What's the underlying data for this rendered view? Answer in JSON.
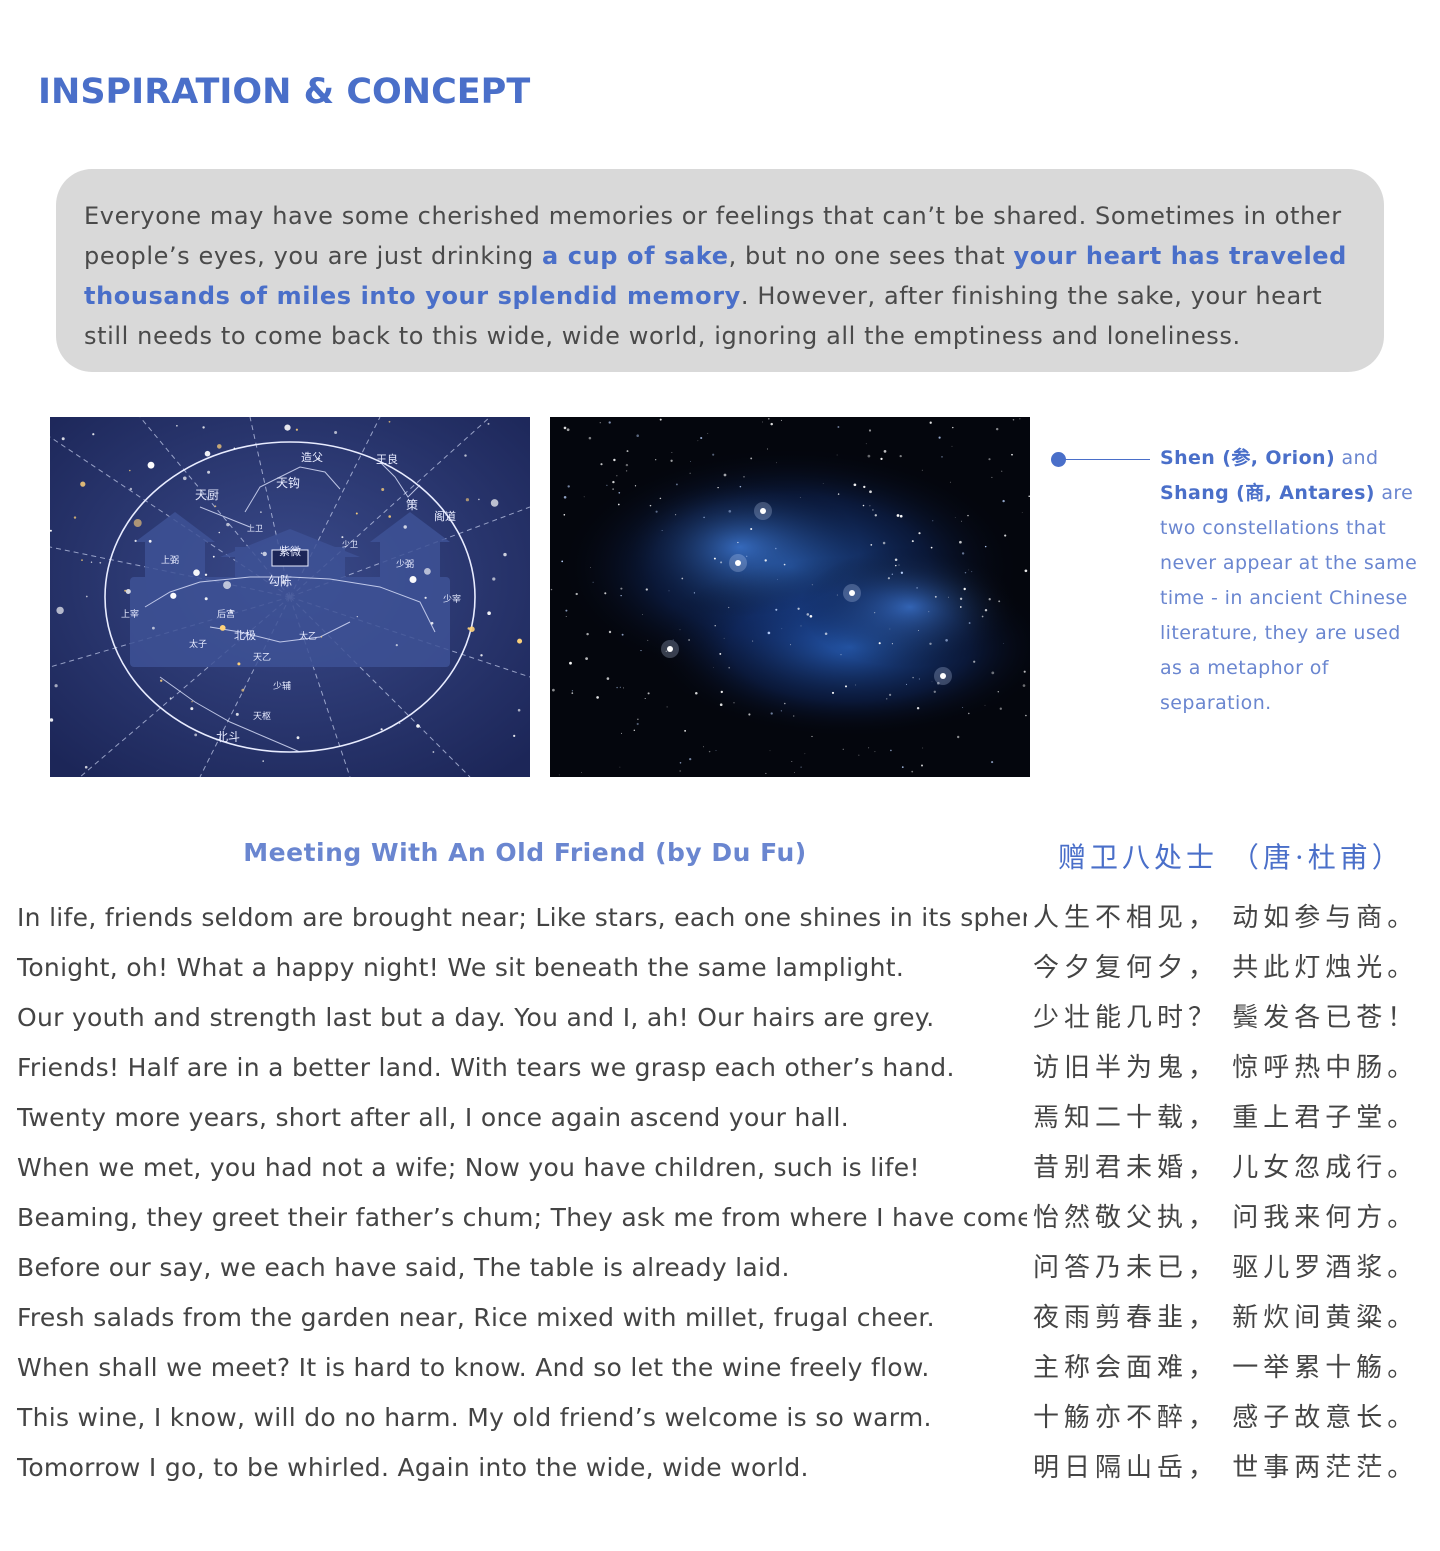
{
  "section": {
    "title": "INSPIRATION & CONCEPT"
  },
  "intro": {
    "p1": "Everyone may have some cherished memories or feelings that can’t be shared. Sometimes in other people’s eyes, you are just drinking ",
    "hl1": "a cup of sake",
    "p2": ", but no one sees that ",
    "hl2": "your heart has traveled thousands of miles into your splendid memory",
    "p3": ". However, after finishing the sake, your heart still needs to come back to this wide, wide world, ignoring all the emptiness and loneliness."
  },
  "images": {
    "left": {
      "name": "chinese-star-map-image",
      "labels": [
        "紫微",
        "天钩",
        "造父",
        "王良",
        "天厨",
        "策",
        "阁道",
        "勾陈",
        "北极",
        "北斗",
        "天枢",
        "少辅",
        "上卫",
        "少卫",
        "上弼",
        "少弼",
        "上宰",
        "少宰",
        "太子",
        "后宫",
        "天乙",
        "太乙"
      ]
    },
    "right": {
      "name": "starry-nebula-image"
    }
  },
  "callout": {
    "b1": "Shen (参, Orion)",
    "t1": " and ",
    "b2": "Shang (商, Antares)",
    "t2": " are two constellations that never appear at the same time - in ancient Chinese literature, they are used as a metaphor of separation."
  },
  "poem": {
    "title_en": "Meeting With An Old Friend (by Du Fu)",
    "title_zh": "赠卫八处士 （唐·杜甫）",
    "lines_en": [
      "In life, friends seldom are brought near; Like stars, each one shines in its sphere.",
      "Tonight, oh! What a happy night! We sit beneath the same lamplight.",
      "Our youth and strength last but a day. You and I, ah! Our hairs are grey.",
      "Friends! Half are in a better land. With tears we grasp each other’s hand.",
      "Twenty more years, short after all, I once again ascend your hall.",
      "When we met, you had not a wife; Now you have children, such is life!",
      "Beaming, they greet their father’s chum; They ask me from where I have come.",
      "Before our say, we each have said, The table is already laid.",
      "Fresh salads from the garden near, Rice mixed with millet, frugal cheer.",
      "When shall we meet? It is hard to know. And so let the wine freely flow.",
      "This wine, I know, will do no harm. My old friend’s welcome is so warm.",
      "Tomorrow I go, to be whirled. Again into the wide, wide world."
    ],
    "lines_zh": [
      "人生不相见， 动如参与商。",
      "今夕复何夕， 共此灯烛光。",
      "少壮能几时？ 鬓发各已苍！",
      "访旧半为鬼， 惊呼热中肠。",
      "焉知二十载， 重上君子堂。",
      "昔别君未婚， 儿女忽成行。",
      "怡然敬父执， 问我来何方。",
      "问答乃未已， 驱儿罗酒浆。",
      "夜雨剪春韭， 新炊间黄粱。",
      "主称会面难， 一举累十觞。",
      "十觞亦不醉， 感子故意长。",
      "明日隔山岳， 世事两茫茫。"
    ]
  },
  "colors": {
    "accent": "#4a6fc9",
    "accent_light": "#6a86d0",
    "box_bg": "#d9d9d9",
    "text": "#444444"
  }
}
